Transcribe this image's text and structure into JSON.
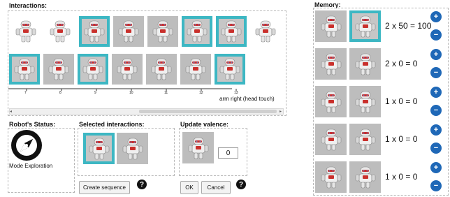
{
  "interactions": {
    "title": "Interactions:",
    "row1_selected": [
      false,
      false,
      true,
      false,
      false,
      true,
      true,
      false
    ],
    "row2_selected": [
      true,
      false,
      true,
      false,
      false,
      false,
      true
    ],
    "timeline_ticks": [
      "7",
      "8",
      "9",
      "10",
      "11",
      "12",
      "13"
    ],
    "timeline_label": "arm right (head touch)",
    "scroll_left": "◂",
    "scroll_right": "▸"
  },
  "memory": {
    "title": "Memory:",
    "rows": [
      {
        "text": "2 x 50 = 100",
        "plus": "+",
        "minus": "−"
      },
      {
        "text": "2 x 0 = 0",
        "plus": "+",
        "minus": "−"
      },
      {
        "text": "1 x 0 = 0",
        "plus": "+",
        "minus": "−"
      },
      {
        "text": "1 x 0 = 0",
        "plus": "+",
        "minus": "−"
      },
      {
        "text": "1 x 0 = 0",
        "plus": "+",
        "minus": "−"
      }
    ]
  },
  "status": {
    "title": "Robot's Status:",
    "mode": "Mode Exploration",
    "icon": "compass-icon"
  },
  "selected": {
    "title": "Selected interactions:",
    "create_label": "Create sequence",
    "help": "?"
  },
  "valence": {
    "title": "Update valence:",
    "value": "0",
    "ok_label": "OK",
    "cancel_label": "Cancel",
    "help": "?"
  },
  "colors": {
    "selected_border": "#3db7c3",
    "circle_button": "#1f68b7"
  }
}
